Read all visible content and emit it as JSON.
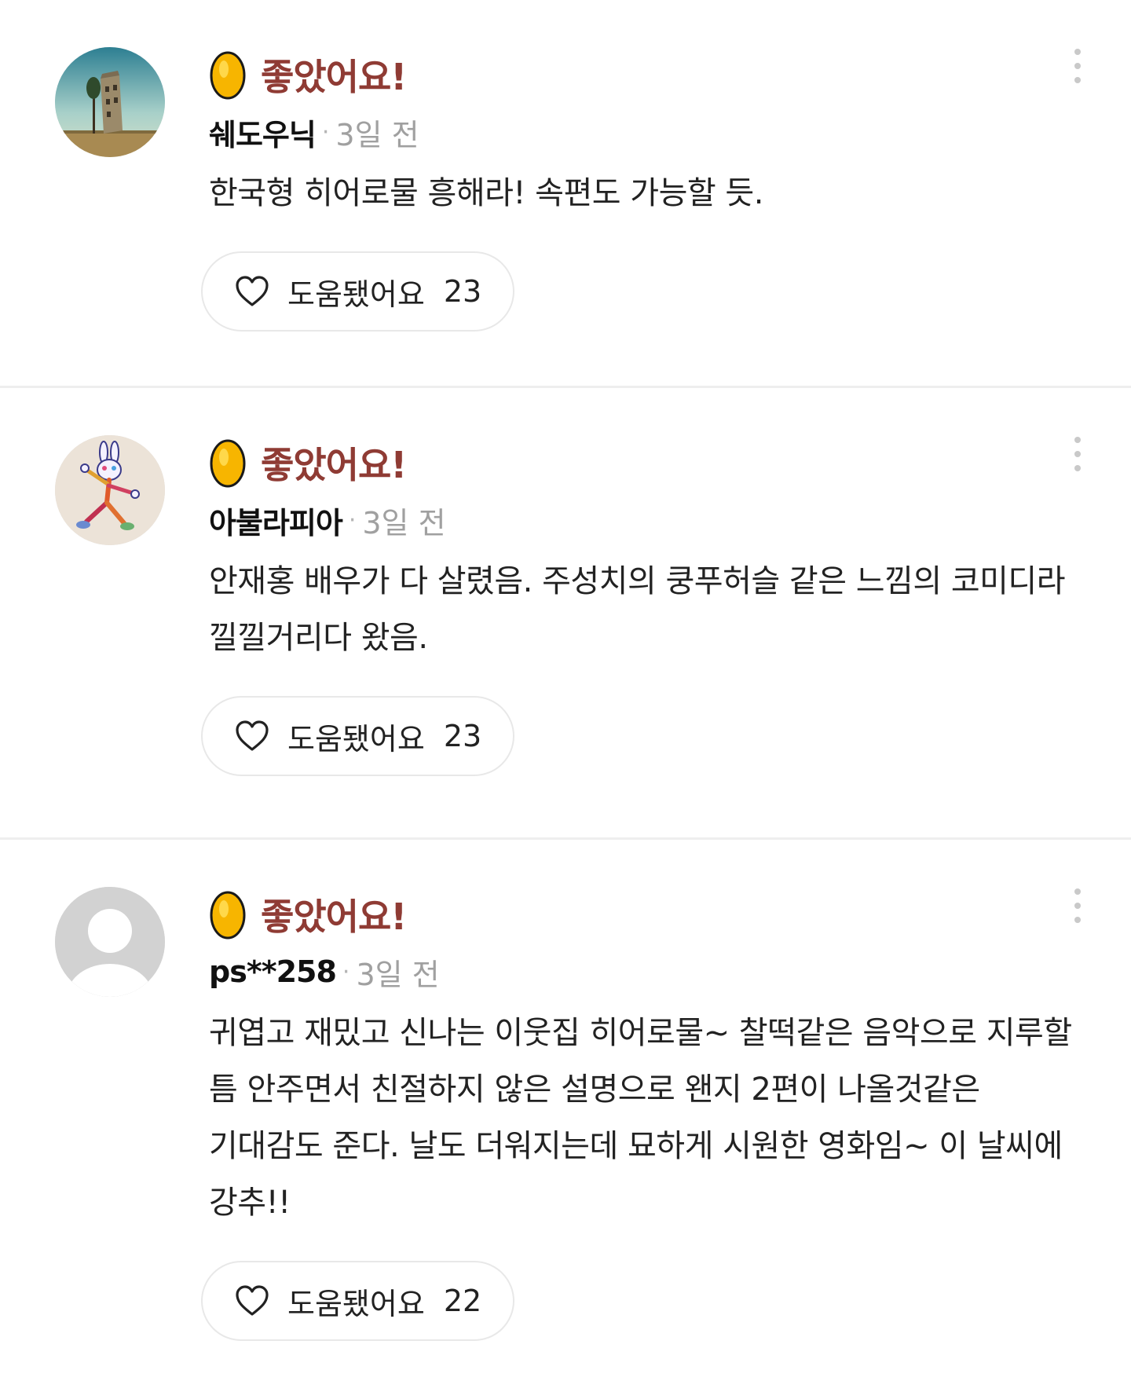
{
  "reviews": [
    {
      "avatar": "tower-painting-avatar",
      "rating_label": "좋았어요!",
      "author": "쉐도우닉",
      "time": "3일 전",
      "content": "한국형 히어로물 흥해라! 속편도 가능할 듯.",
      "helpful_label": "도움됐어요",
      "helpful_count": "23"
    },
    {
      "avatar": "rabbit-drawing-avatar",
      "rating_label": "좋았어요!",
      "author": "아불라피아",
      "time": "3일 전",
      "content": "안재홍 배우가 다 살렸음. 주성치의 쿵푸허슬 같은 느낌의 코미디라 낄낄거리다 왔음.",
      "helpful_label": "도움됐어요",
      "helpful_count": "23"
    },
    {
      "avatar": "default-user-avatar",
      "rating_label": "좋았어요!",
      "author": "ps**258",
      "time": "3일 전",
      "content": "귀엽고 재밌고 신나는 이웃집 히어로물~ 찰떡같은 음악으로 지루할 틈 안주면서 친절하지 않은 설명으로 왠지 2편이 나올것같은 기대감도 준다. 날도 더워지는데 묘하게 시원한 영화임~ 이 날씨에 강추!!",
      "helpful_label": "도움됐어요",
      "helpful_count": "22"
    }
  ],
  "colors": {
    "rating_text": "#8f3b34",
    "egg_fill": "#f7b500",
    "divider": "#eeeeee"
  },
  "icons": {
    "rating": "golden-egg-icon",
    "helpful": "heart-outline-icon",
    "more": "more-vertical-icon"
  }
}
